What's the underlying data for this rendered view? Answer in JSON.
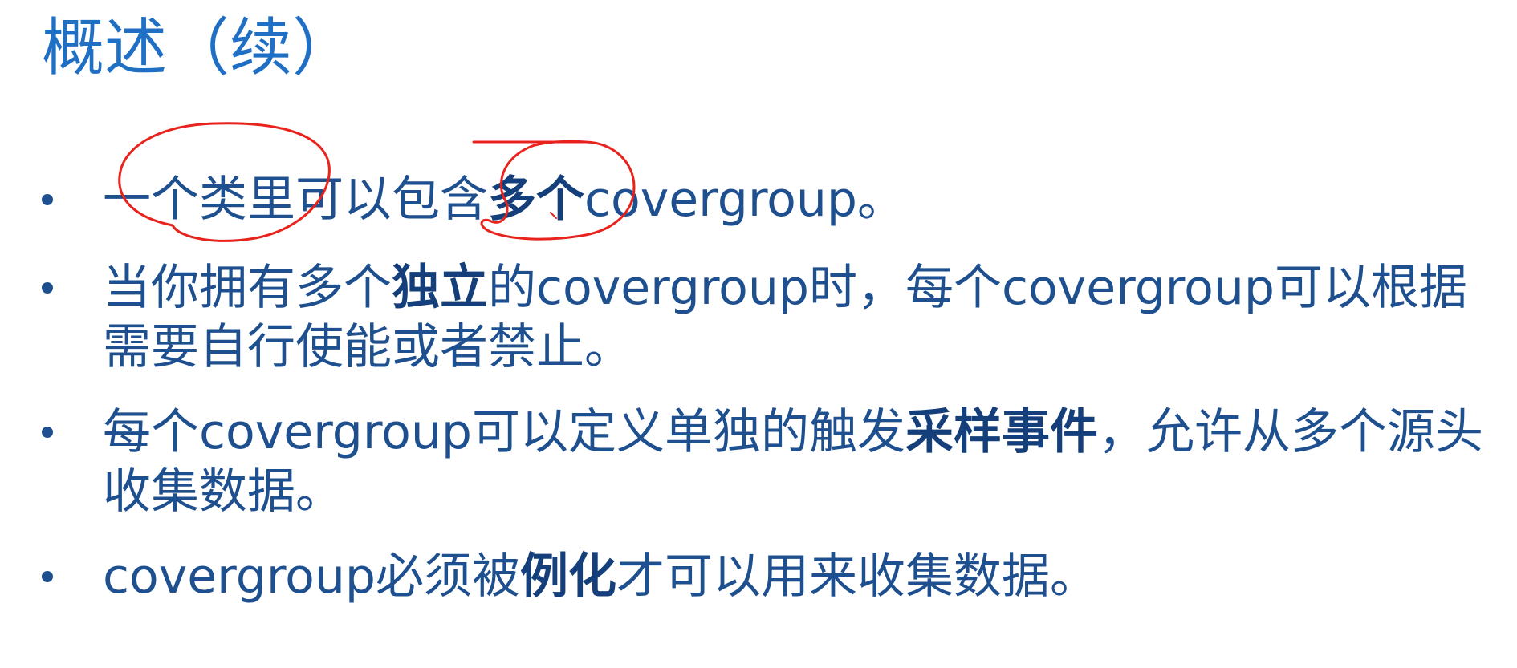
{
  "slide": {
    "title": "概述（续）",
    "bullets": [
      {
        "segments": [
          {
            "text": "一个类里可以包含",
            "bold": false
          },
          {
            "text": "多个",
            "bold": true
          },
          {
            "text": "covergroup。",
            "bold": false
          }
        ]
      },
      {
        "segments": [
          {
            "text": "当你拥有多个",
            "bold": false
          },
          {
            "text": "独立",
            "bold": true
          },
          {
            "text": "的covergroup时，每个covergroup可以根据需要自行使能或者禁止。",
            "bold": false
          }
        ]
      },
      {
        "segments": [
          {
            "text": "每个covergroup可以定义单独的触发",
            "bold": false
          },
          {
            "text": "采样事件",
            "bold": true
          },
          {
            "text": "，允许从多个源头收集数据。",
            "bold": false
          }
        ]
      },
      {
        "segments": [
          {
            "text": "covergroup必须被",
            "bold": false
          },
          {
            "text": "例化",
            "bold": true
          },
          {
            "text": "才可以用来收集数据。",
            "bold": false
          }
        ]
      }
    ]
  },
  "colors": {
    "title": "#1f6fc5",
    "body_text": "#1e4f8f",
    "annotation_ink": "#e8231d"
  }
}
